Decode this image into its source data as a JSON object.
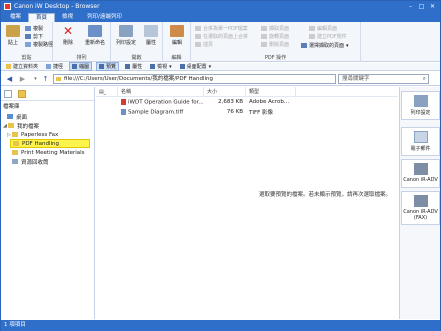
{
  "app": {
    "title": "Canon iW Desktop - Browser",
    "controls": [
      "–",
      "□",
      "✕"
    ]
  },
  "tabs": [
    {
      "label": "檔案"
    },
    {
      "label": "首頁"
    },
    {
      "label": "檢視"
    },
    {
      "label": "列印/遠端列印"
    }
  ],
  "ribbon": {
    "clipboard": {
      "label": "剪貼",
      "paste": "貼上",
      "copy": "複製",
      "cut": "剪下",
      "copy_path": "複製路徑"
    },
    "organize": {
      "label": "排列",
      "delete": "刪除",
      "rename": "重新命名"
    },
    "open": {
      "label": "開啟",
      "print_settings": "列印設定",
      "properties": "屬性"
    },
    "edit": {
      "label": "編輯",
      "edit": "編輯"
    },
    "pdf": {
      "label": "PDF 操作",
      "items": [
        "合併為單一PDF檔案",
        "在選取的頁面上合併",
        "插頁",
        "擷取頁面",
        "旋轉頁面",
        "刪除頁面",
        "編輯頁面",
        "建立PDF附件"
      ],
      "select_pages": "選擇擷取的頁面"
    }
  },
  "toolbar2": {
    "new_folder": "建立資料夾",
    "favorites": "捷徑",
    "library": "縮圖",
    "preview": "預覽",
    "details": "屬性",
    "view": "檢視",
    "display": "桌面配置"
  },
  "address": {
    "path": "file:///C:/Users/User/Documents/我的檔案/PDF Handling",
    "search_placeholder": "搜尋關鍵字"
  },
  "left_pane": {
    "header": "檔案庫",
    "nodes": [
      {
        "label": "桌面",
        "level": 1
      },
      {
        "label": "我的檔案",
        "level": 1
      },
      {
        "label": "Paperless Fax",
        "level": 2
      },
      {
        "label": "PDF Handling",
        "level": 2,
        "selected": true
      },
      {
        "label": "Print Meeting Materials",
        "level": 2
      },
      {
        "label": "資源回收筒",
        "level": 1
      }
    ]
  },
  "file_list": {
    "columns": [
      "名稱",
      "大小",
      "類型"
    ],
    "rows": [
      {
        "name": "iWDT Operation Guide for...",
        "size": "2,683 KB",
        "type": "Adobe Acrob...",
        "icon": "pdf-icon"
      },
      {
        "name": "Sample Diagram.tiff",
        "size": "76 KB",
        "type": "TIFF 影像",
        "icon": "tiff-icon"
      }
    ],
    "preview_message": "選取要預覽的檔案。若未顯示預覽，請再次選取檔案。"
  },
  "right_pane": {
    "buttons": [
      {
        "label": "列印設定",
        "icon": "printer-icon"
      },
      {
        "label": "電子郵件",
        "icon": "email-icon"
      },
      {
        "label": "Canon iR-ADV",
        "icon": "printer-icon"
      },
      {
        "label": "Canon iR-ADV (FAX)",
        "icon": "fax-icon"
      }
    ]
  },
  "status": {
    "text": "1 項項目"
  },
  "colors": {
    "accent": "#2f6fc9",
    "selection": "#fff34d",
    "folder": "#e9c34b"
  }
}
